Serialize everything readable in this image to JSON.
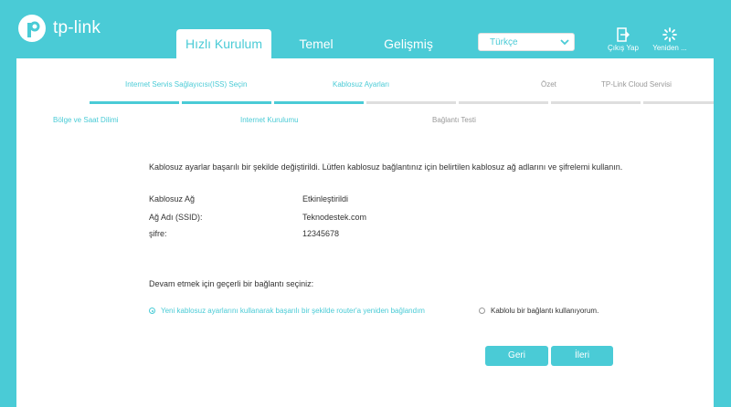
{
  "header": {
    "logo_text": "tp-link",
    "tabs": [
      "Hızlı Kurulum",
      "Temel",
      "Gelişmiş"
    ],
    "language": "Türkçe",
    "logout_label": "Çıkış Yap",
    "reboot_label": "Yeniden ..."
  },
  "steps_top": [
    "Internet Servis Sağlayıcısı(ISS) Seçin",
    "Kablosuz Ayarları",
    "Özet",
    "TP-Link Cloud Servisi"
  ],
  "steps_bottom": [
    "Bölge ve Saat Dilimi",
    "Internet Kurulumu",
    "Bağlantı Testi"
  ],
  "progress": {
    "total_segments": 7,
    "completed_segments": 3
  },
  "message": "Kablosuz ayarlar başarılı bir şekilde değiştirildi. Lütfen kablosuz bağlantınız için belirtilen kablosuz ağ adlarını ve şifrelemi kullanın.",
  "info": [
    {
      "label": "Kablosuz Ağ",
      "value": "Etkinleştirildi"
    },
    {
      "label": "Ağ Adı (SSID):",
      "value": "Teknodestek.com"
    },
    {
      "label": "şifre:",
      "value": "12345678"
    }
  ],
  "prompt": "Devam etmek için geçerli bir bağlantı seçiniz:",
  "options": [
    {
      "label": "Yeni kablosuz ayarlarını kullanarak başarılı bir şekilde router'a yeniden bağlandım",
      "selected": true
    },
    {
      "label": "Kablolu bir bağlantı kullanıyorum.",
      "selected": false
    }
  ],
  "buttons": {
    "back": "Geri",
    "next": "İleri"
  },
  "colors": {
    "accent": "#4acbd6",
    "background": "#ffffff"
  }
}
